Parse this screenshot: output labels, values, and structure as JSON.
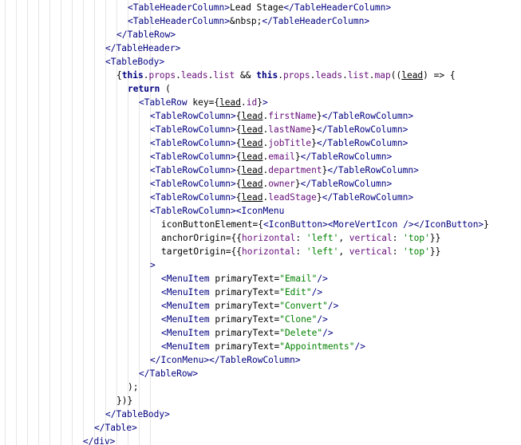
{
  "editor": {
    "lines": [
      {
        "indent": 160,
        "tokens": [
          {
            "t": "<TableHeaderColumn>",
            "c": "tag"
          },
          {
            "t": "Lead Stage",
            "c": "plain"
          },
          {
            "t": "</TableHeaderColumn>",
            "c": "tag"
          }
        ]
      },
      {
        "indent": 160,
        "tokens": [
          {
            "t": "<TableHeaderColumn>",
            "c": "tag"
          },
          {
            "t": "&nbsp;",
            "c": "plain"
          },
          {
            "t": "</TableHeaderColumn>",
            "c": "tag"
          }
        ]
      },
      {
        "indent": 146,
        "tokens": [
          {
            "t": "</TableRow>",
            "c": "tag"
          }
        ]
      },
      {
        "indent": 132,
        "tokens": [
          {
            "t": "</TableHeader>",
            "c": "tag"
          }
        ]
      },
      {
        "indent": 132,
        "tokens": [
          {
            "t": "<TableBody>",
            "c": "tag"
          }
        ]
      },
      {
        "indent": 146,
        "tokens": [
          {
            "t": "{",
            "c": "punc"
          },
          {
            "t": "this",
            "c": "kw"
          },
          {
            "t": ".",
            "c": "punc"
          },
          {
            "t": "props",
            "c": "prop"
          },
          {
            "t": ".",
            "c": "punc"
          },
          {
            "t": "leads",
            "c": "prop"
          },
          {
            "t": ".",
            "c": "punc"
          },
          {
            "t": "list",
            "c": "prop"
          },
          {
            "t": " && ",
            "c": "punc"
          },
          {
            "t": "this",
            "c": "kw"
          },
          {
            "t": ".",
            "c": "punc"
          },
          {
            "t": "props",
            "c": "prop"
          },
          {
            "t": ".",
            "c": "punc"
          },
          {
            "t": "leads",
            "c": "prop"
          },
          {
            "t": ".",
            "c": "punc"
          },
          {
            "t": "list",
            "c": "prop"
          },
          {
            "t": ".",
            "c": "punc"
          },
          {
            "t": "map",
            "c": "prop"
          },
          {
            "t": "((",
            "c": "punc"
          },
          {
            "t": "lead",
            "c": "var"
          },
          {
            "t": ") => {",
            "c": "punc"
          }
        ]
      },
      {
        "indent": 160,
        "tokens": [
          {
            "t": "return",
            "c": "kw"
          },
          {
            "t": " (",
            "c": "punc"
          }
        ]
      },
      {
        "indent": 174,
        "tokens": [
          {
            "t": "<TableRow",
            "c": "tag"
          },
          {
            "t": " key",
            "c": "attr"
          },
          {
            "t": "={",
            "c": "punc"
          },
          {
            "t": "lead",
            "c": "var"
          },
          {
            "t": ".",
            "c": "punc"
          },
          {
            "t": "id",
            "c": "prop"
          },
          {
            "t": "}",
            "c": "punc"
          },
          {
            "t": ">",
            "c": "tag"
          }
        ]
      },
      {
        "indent": 188,
        "tokens": [
          {
            "t": "<TableRowColumn>",
            "c": "tag"
          },
          {
            "t": "{",
            "c": "punc"
          },
          {
            "t": "lead",
            "c": "var"
          },
          {
            "t": ".",
            "c": "punc"
          },
          {
            "t": "firstName",
            "c": "prop"
          },
          {
            "t": "}",
            "c": "punc"
          },
          {
            "t": "</TableRowColumn>",
            "c": "tag"
          }
        ]
      },
      {
        "indent": 188,
        "tokens": [
          {
            "t": "<TableRowColumn>",
            "c": "tag"
          },
          {
            "t": "{",
            "c": "punc"
          },
          {
            "t": "lead",
            "c": "var"
          },
          {
            "t": ".",
            "c": "punc"
          },
          {
            "t": "lastName",
            "c": "prop"
          },
          {
            "t": "}",
            "c": "punc"
          },
          {
            "t": "</TableRowColumn>",
            "c": "tag"
          }
        ]
      },
      {
        "indent": 188,
        "tokens": [
          {
            "t": "<TableRowColumn>",
            "c": "tag"
          },
          {
            "t": "{",
            "c": "punc"
          },
          {
            "t": "lead",
            "c": "var"
          },
          {
            "t": ".",
            "c": "punc"
          },
          {
            "t": "jobTitle",
            "c": "prop"
          },
          {
            "t": "}",
            "c": "punc"
          },
          {
            "t": "</TableRowColumn>",
            "c": "tag"
          }
        ]
      },
      {
        "indent": 188,
        "tokens": [
          {
            "t": "<TableRowColumn>",
            "c": "tag"
          },
          {
            "t": "{",
            "c": "punc"
          },
          {
            "t": "lead",
            "c": "var"
          },
          {
            "t": ".",
            "c": "punc"
          },
          {
            "t": "email",
            "c": "prop"
          },
          {
            "t": "}",
            "c": "punc"
          },
          {
            "t": "</TableRowColumn>",
            "c": "tag"
          }
        ]
      },
      {
        "indent": 188,
        "tokens": [
          {
            "t": "<TableRowColumn>",
            "c": "tag"
          },
          {
            "t": "{",
            "c": "punc"
          },
          {
            "t": "lead",
            "c": "var"
          },
          {
            "t": ".",
            "c": "punc"
          },
          {
            "t": "department",
            "c": "prop"
          },
          {
            "t": "}",
            "c": "punc"
          },
          {
            "t": "</TableRowColumn>",
            "c": "tag"
          }
        ]
      },
      {
        "indent": 188,
        "tokens": [
          {
            "t": "<TableRowColumn>",
            "c": "tag"
          },
          {
            "t": "{",
            "c": "punc"
          },
          {
            "t": "lead",
            "c": "var"
          },
          {
            "t": ".",
            "c": "punc"
          },
          {
            "t": "owner",
            "c": "prop"
          },
          {
            "t": "}",
            "c": "punc"
          },
          {
            "t": "</TableRowColumn>",
            "c": "tag"
          }
        ]
      },
      {
        "indent": 188,
        "tokens": [
          {
            "t": "<TableRowColumn>",
            "c": "tag"
          },
          {
            "t": "{",
            "c": "punc"
          },
          {
            "t": "lead",
            "c": "var"
          },
          {
            "t": ".",
            "c": "punc"
          },
          {
            "t": "leadStage",
            "c": "prop"
          },
          {
            "t": "}",
            "c": "punc"
          },
          {
            "t": "</TableRowColumn>",
            "c": "tag"
          }
        ]
      },
      {
        "indent": 188,
        "tokens": [
          {
            "t": "<TableRowColumn>",
            "c": "tag"
          },
          {
            "t": "<IconMenu",
            "c": "tag"
          }
        ]
      },
      {
        "indent": 202,
        "tokens": [
          {
            "t": "iconButtonElement",
            "c": "attr"
          },
          {
            "t": "={",
            "c": "punc"
          },
          {
            "t": "<IconButton>",
            "c": "tag"
          },
          {
            "t": "<MoreVertIcon />",
            "c": "tag"
          },
          {
            "t": "</IconButton>",
            "c": "tag"
          },
          {
            "t": "}",
            "c": "punc"
          }
        ]
      },
      {
        "indent": 202,
        "tokens": [
          {
            "t": "anchorOrigin",
            "c": "attr"
          },
          {
            "t": "={{",
            "c": "punc"
          },
          {
            "t": "horizontal",
            "c": "prop"
          },
          {
            "t": ": ",
            "c": "punc"
          },
          {
            "t": "'left'",
            "c": "str"
          },
          {
            "t": ", ",
            "c": "punc"
          },
          {
            "t": "vertical",
            "c": "prop"
          },
          {
            "t": ": ",
            "c": "punc"
          },
          {
            "t": "'top'",
            "c": "str"
          },
          {
            "t": "}}",
            "c": "punc"
          }
        ]
      },
      {
        "indent": 202,
        "tokens": [
          {
            "t": "targetOrigin",
            "c": "attr"
          },
          {
            "t": "={{",
            "c": "punc"
          },
          {
            "t": "horizontal",
            "c": "prop"
          },
          {
            "t": ": ",
            "c": "punc"
          },
          {
            "t": "'left'",
            "c": "str"
          },
          {
            "t": ", ",
            "c": "punc"
          },
          {
            "t": "vertical",
            "c": "prop"
          },
          {
            "t": ": ",
            "c": "punc"
          },
          {
            "t": "'top'",
            "c": "str"
          },
          {
            "t": "}}",
            "c": "punc"
          }
        ]
      },
      {
        "indent": 188,
        "tokens": [
          {
            "t": ">",
            "c": "tag"
          }
        ]
      },
      {
        "indent": 202,
        "tokens": [
          {
            "t": "<MenuItem",
            "c": "tag"
          },
          {
            "t": " primaryText",
            "c": "attr"
          },
          {
            "t": "=",
            "c": "punc"
          },
          {
            "t": "\"Email\"",
            "c": "str"
          },
          {
            "t": "/>",
            "c": "tag"
          }
        ]
      },
      {
        "indent": 202,
        "tokens": [
          {
            "t": "<MenuItem",
            "c": "tag"
          },
          {
            "t": " primaryText",
            "c": "attr"
          },
          {
            "t": "=",
            "c": "punc"
          },
          {
            "t": "\"Edit\"",
            "c": "str"
          },
          {
            "t": "/>",
            "c": "tag"
          }
        ]
      },
      {
        "indent": 202,
        "tokens": [
          {
            "t": "<MenuItem",
            "c": "tag"
          },
          {
            "t": " primaryText",
            "c": "attr"
          },
          {
            "t": "=",
            "c": "punc"
          },
          {
            "t": "\"Convert\"",
            "c": "str"
          },
          {
            "t": "/>",
            "c": "tag"
          }
        ]
      },
      {
        "indent": 202,
        "tokens": [
          {
            "t": "<MenuItem",
            "c": "tag"
          },
          {
            "t": " primaryText",
            "c": "attr"
          },
          {
            "t": "=",
            "c": "punc"
          },
          {
            "t": "\"Clone\"",
            "c": "str"
          },
          {
            "t": "/>",
            "c": "tag"
          }
        ]
      },
      {
        "indent": 202,
        "tokens": [
          {
            "t": "<MenuItem",
            "c": "tag"
          },
          {
            "t": " primaryText",
            "c": "attr"
          },
          {
            "t": "=",
            "c": "punc"
          },
          {
            "t": "\"Delete\"",
            "c": "str"
          },
          {
            "t": "/>",
            "c": "tag"
          }
        ]
      },
      {
        "indent": 202,
        "tokens": [
          {
            "t": "<MenuItem",
            "c": "tag"
          },
          {
            "t": " primaryText",
            "c": "attr"
          },
          {
            "t": "=",
            "c": "punc"
          },
          {
            "t": "\"Appointments\"",
            "c": "str"
          },
          {
            "t": "/>",
            "c": "tag"
          }
        ]
      },
      {
        "indent": 188,
        "tokens": [
          {
            "t": "</IconMenu>",
            "c": "tag"
          },
          {
            "t": "</TableRowColumn>",
            "c": "tag"
          }
        ]
      },
      {
        "indent": 174,
        "tokens": [
          {
            "t": "</TableRow>",
            "c": "tag"
          }
        ]
      },
      {
        "indent": 160,
        "tokens": [
          {
            "t": ");",
            "c": "punc"
          }
        ]
      },
      {
        "indent": 146,
        "tokens": [
          {
            "t": "})}",
            "c": "punc"
          }
        ]
      },
      {
        "indent": 132,
        "tokens": [
          {
            "t": "</TableBody>",
            "c": "tag"
          }
        ]
      },
      {
        "indent": 118,
        "tokens": [
          {
            "t": "</Table>",
            "c": "tag"
          }
        ]
      },
      {
        "indent": 104,
        "tokens": [
          {
            "t": "</div>",
            "c": "tag"
          }
        ]
      }
    ]
  }
}
